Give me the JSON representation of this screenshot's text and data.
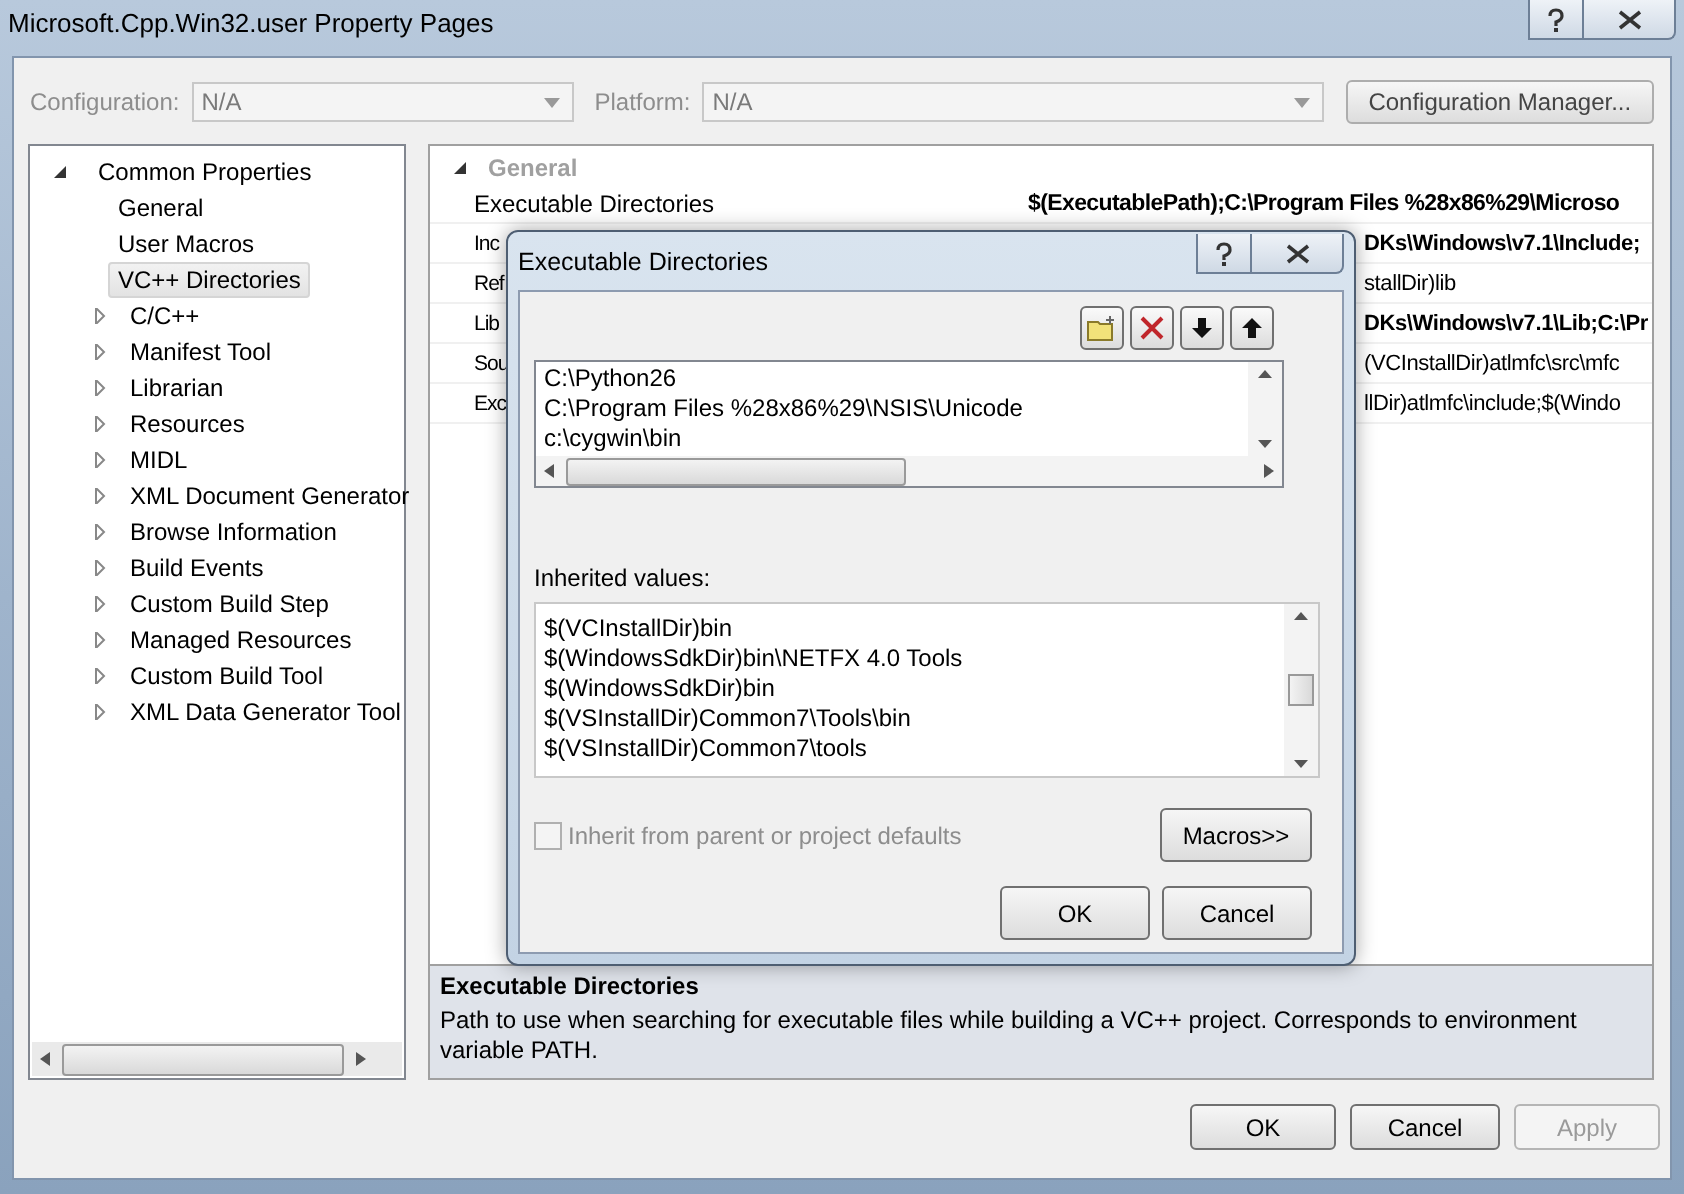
{
  "window": {
    "title": "Microsoft.Cpp.Win32.user Property Pages"
  },
  "toolbar": {
    "configuration": {
      "label": "Configuration:",
      "value": "N/A",
      "disabled": true
    },
    "platform": {
      "label": "Platform:",
      "value": "N/A",
      "disabled": true
    },
    "manager_button": "Configuration Manager..."
  },
  "tree": [
    {
      "label": "Common Properties",
      "expanded": true,
      "selected": false,
      "children": [
        {
          "label": "General",
          "selected": false
        },
        {
          "label": "User Macros",
          "selected": false
        },
        {
          "label": "VC++ Directories",
          "selected": true
        },
        {
          "label": "C/C++",
          "selected": false,
          "expanded": false
        },
        {
          "label": "Manifest Tool",
          "selected": false,
          "expanded": false
        },
        {
          "label": "Librarian",
          "selected": false,
          "expanded": false
        },
        {
          "label": "Resources",
          "selected": false,
          "expanded": false
        },
        {
          "label": "MIDL",
          "selected": false,
          "expanded": false
        },
        {
          "label": "XML Document Generator",
          "selected": false,
          "expanded": false
        },
        {
          "label": "Browse Information",
          "selected": false,
          "expanded": false
        },
        {
          "label": "Build Events",
          "selected": false,
          "expanded": false
        },
        {
          "label": "Custom Build Step",
          "selected": false,
          "expanded": false
        },
        {
          "label": "Managed Resources",
          "selected": false,
          "expanded": false
        },
        {
          "label": "Custom Build Tool",
          "selected": false,
          "expanded": false
        },
        {
          "label": "XML Data Generator Tool",
          "selected": false,
          "expanded": false
        }
      ]
    }
  ],
  "grid": {
    "category": {
      "label": "General",
      "expanded": true
    },
    "rows": [
      {
        "name": "Executable Directories",
        "value": "$(ExecutablePath);C:\\Program Files %28x86%29\\Microso",
        "bold": true,
        "covered": false
      },
      {
        "name": "Inc",
        "value": "DKs\\Windows\\v7.1\\Include;",
        "bold": true,
        "covered": true
      },
      {
        "name": "Ref",
        "value": "stallDir)lib",
        "bold": false,
        "covered": true
      },
      {
        "name": "Lib",
        "value": "DKs\\Windows\\v7.1\\Lib;C:\\Pr",
        "bold": true,
        "covered": true
      },
      {
        "name": "Sou",
        "value": "(VCInstallDir)atlmfc\\src\\mfc",
        "bold": false,
        "covered": true
      },
      {
        "name": "Exc",
        "value": "llDir)atlmfc\\include;$(Windo",
        "bold": false,
        "covered": true
      }
    ]
  },
  "description": {
    "title": "Executable Directories",
    "text": "Path to use when searching for executable files while building a VC++ project.  Corresponds to environment variable PATH."
  },
  "buttons": [
    {
      "label": "OK",
      "disabled": false
    },
    {
      "label": "Cancel",
      "disabled": false
    },
    {
      "label": "Apply",
      "disabled": true
    }
  ],
  "dialog": {
    "title": "Executable Directories",
    "entries": [
      "C:\\Python26",
      "C:\\Program Files %28x86%29\\NSIS\\Unicode",
      "c:\\cygwin\\bin"
    ],
    "inherited_label": "Inherited values:",
    "inherited": [
      "$(VCInstallDir)bin",
      "$(WindowsSdkDir)bin\\NETFX 4.0 Tools",
      "$(WindowsSdkDir)bin",
      "$(VSInstallDir)Common7\\Tools\\bin",
      "$(VSInstallDir)Common7\\tools"
    ],
    "inherit_checkbox": {
      "label": "Inherit from parent or project defaults",
      "checked": false,
      "disabled": true
    },
    "macros_button": "Macros>>",
    "buttons": [
      "OK",
      "Cancel"
    ]
  }
}
